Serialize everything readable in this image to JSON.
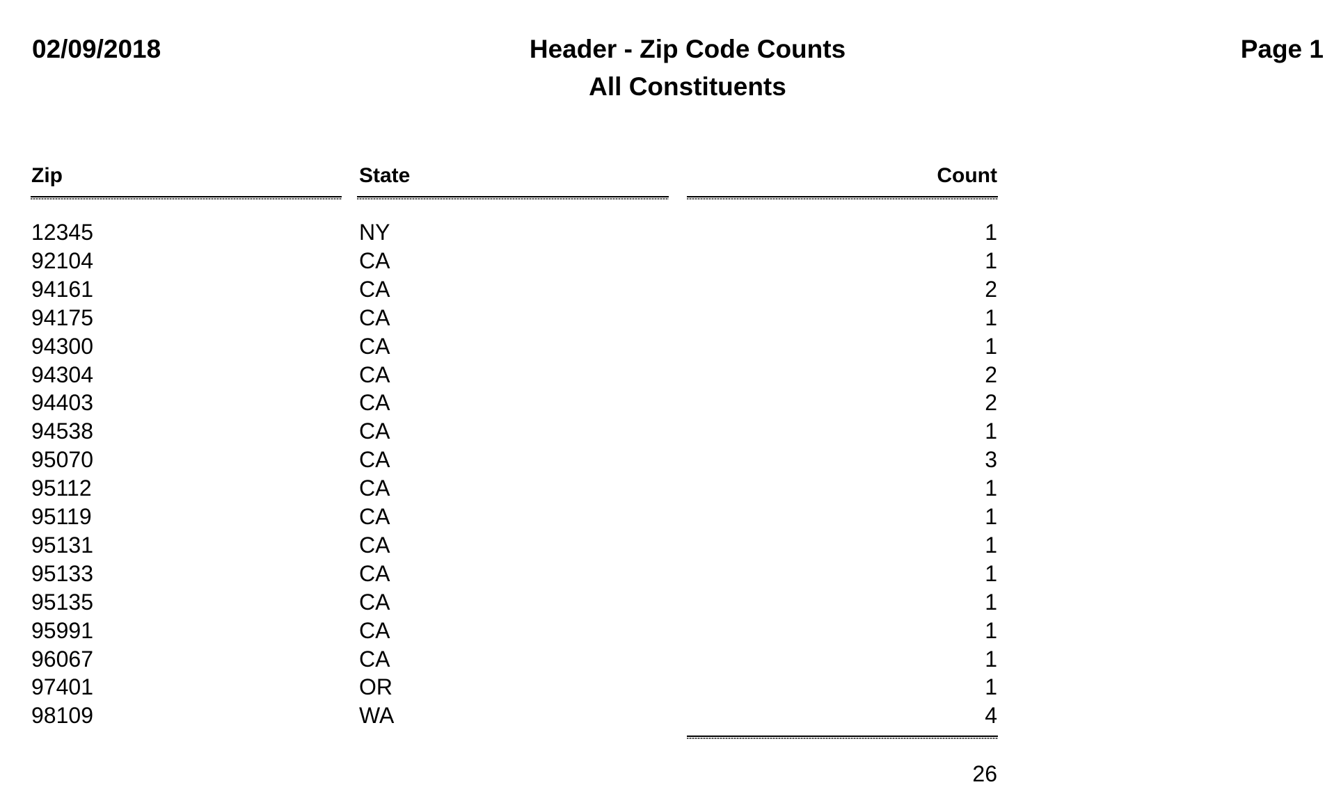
{
  "report": {
    "date": "02/09/2018",
    "title": "Header - Zip Code Counts",
    "subtitle": "All Constituents",
    "page": "Page 1"
  },
  "table": {
    "columns": [
      "Zip",
      "State",
      "Count"
    ],
    "rows": [
      {
        "zip": "12345",
        "state": "NY",
        "count": "1"
      },
      {
        "zip": "92104",
        "state": "CA",
        "count": "1"
      },
      {
        "zip": "94161",
        "state": "CA",
        "count": "2"
      },
      {
        "zip": "94175",
        "state": "CA",
        "count": "1"
      },
      {
        "zip": "94300",
        "state": "CA",
        "count": "1"
      },
      {
        "zip": "94304",
        "state": "CA",
        "count": "2"
      },
      {
        "zip": "94403",
        "state": "CA",
        "count": "2"
      },
      {
        "zip": "94538",
        "state": "CA",
        "count": "1"
      },
      {
        "zip": "95070",
        "state": "CA",
        "count": "3"
      },
      {
        "zip": "95112",
        "state": "CA",
        "count": "1"
      },
      {
        "zip": "95119",
        "state": "CA",
        "count": "1"
      },
      {
        "zip": "95131",
        "state": "CA",
        "count": "1"
      },
      {
        "zip": "95133",
        "state": "CA",
        "count": "1"
      },
      {
        "zip": "95135",
        "state": "CA",
        "count": "1"
      },
      {
        "zip": "95991",
        "state": "CA",
        "count": "1"
      },
      {
        "zip": "96067",
        "state": "CA",
        "count": "1"
      },
      {
        "zip": "97401",
        "state": "OR",
        "count": "1"
      },
      {
        "zip": "98109",
        "state": "WA",
        "count": "4"
      }
    ],
    "total": "26"
  }
}
